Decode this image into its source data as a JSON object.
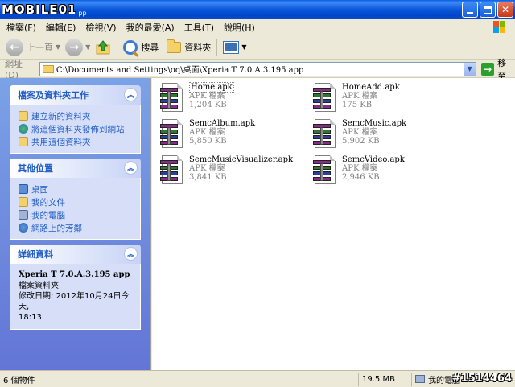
{
  "titlebar": {
    "logo_text": "MOBILE01",
    "logo_sub": "pp"
  },
  "menu": [
    "檔案(F)",
    "編輯(E)",
    "檢視(V)",
    "我的最愛(A)",
    "工具(T)",
    "說明(H)"
  ],
  "toolbar": {
    "back_label": "上一頁",
    "search_label": "搜尋",
    "folders_label": "資料夾"
  },
  "address": {
    "label": "網址(D)",
    "path": "C:\\Documents and Settings\\oq\\桌面\\Xperia T 7.0.A.3.195 app",
    "go_label": "移至"
  },
  "left_pane": {
    "tasks": {
      "title": "檔案及資料夾工作",
      "items": [
        "建立新的資料夾",
        "將這個資料夾發佈到網站",
        "共用這個資料夾"
      ]
    },
    "places": {
      "title": "其他位置",
      "items": [
        "桌面",
        "我的文件",
        "我的電腦",
        "網路上的芳鄰"
      ]
    },
    "details": {
      "title": "詳細資料",
      "name": "Xperia T 7.0.A.3.195 app",
      "type": "檔案資料夾",
      "modified": "修改日期: 2012年10月24日今天,",
      "time": "18:13"
    }
  },
  "files": [
    {
      "name": "Home.apk",
      "type": "APK 檔案",
      "size": "1,204 KB"
    },
    {
      "name": "HomeAdd.apk",
      "type": "APK 檔案",
      "size": "175 KB"
    },
    {
      "name": "SemcAlbum.apk",
      "type": "APK 檔案",
      "size": "5,850 KB"
    },
    {
      "name": "SemcMusic.apk",
      "type": "APK 檔案",
      "size": "5,902 KB"
    },
    {
      "name": "SemcMusicVisualizer.apk",
      "type": "APK 檔案",
      "size": "3,841 KB"
    },
    {
      "name": "SemcVideo.apk",
      "type": "APK 檔案",
      "size": "2,946 KB"
    }
  ],
  "status": {
    "count": "6 個物件",
    "size": "19.5 MB",
    "location": "我的電腦",
    "watermark": "#1514464"
  }
}
